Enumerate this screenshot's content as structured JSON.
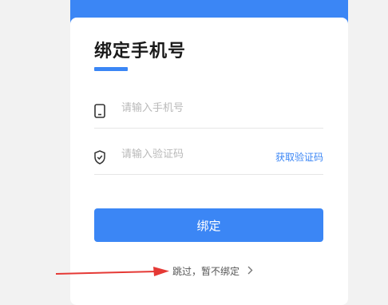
{
  "header": {
    "title": "绑定手机号"
  },
  "form": {
    "phone": {
      "placeholder": "请输入手机号",
      "value": ""
    },
    "code": {
      "placeholder": "请输入验证码",
      "value": "",
      "get_code_label": "获取验证码"
    }
  },
  "actions": {
    "bind_label": "绑定",
    "skip_label": "跳过，暂不绑定"
  },
  "colors": {
    "accent": "#3b86f5",
    "annotation_arrow": "#e53935"
  },
  "icons": {
    "phone": "phone-icon",
    "shield": "shield-check-icon",
    "chevron": "chevron-right-icon"
  }
}
